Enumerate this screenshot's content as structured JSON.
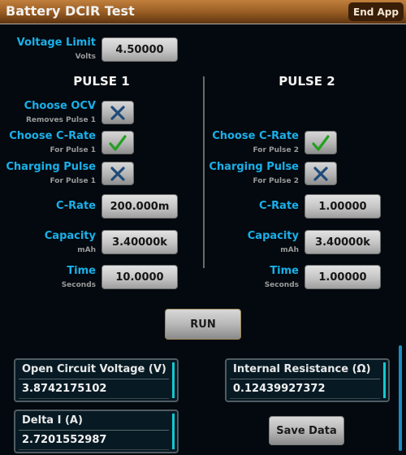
{
  "header": {
    "title": "Battery DCIR Test",
    "end_app_label": "End App"
  },
  "voltage_limit": {
    "label": "Voltage Limit",
    "unit": "Volts",
    "value": "4.50000"
  },
  "pulse1": {
    "title": "PULSE 1",
    "choose_ocv": {
      "label": "Choose OCV",
      "sub": "Removes Pulse 1",
      "checked": false,
      "icon": "x-icon"
    },
    "choose_crate": {
      "label": "Choose C-Rate",
      "sub": "For Pulse 1",
      "checked": true,
      "icon": "check-icon"
    },
    "charging_pulse": {
      "label": "Charging Pulse",
      "sub": "For Pulse 1",
      "checked": false,
      "icon": "x-icon"
    },
    "crate": {
      "label": "C-Rate",
      "value": "200.000m"
    },
    "capacity": {
      "label": "Capacity",
      "unit": "mAh",
      "value": "3.40000k"
    },
    "time": {
      "label": "Time",
      "unit": "Seconds",
      "value": "10.0000"
    }
  },
  "pulse2": {
    "title": "PULSE 2",
    "choose_crate": {
      "label": "Choose C-Rate",
      "sub": "For Pulse 2",
      "checked": true,
      "icon": "check-icon"
    },
    "charging_pulse": {
      "label": "Charging Pulse",
      "sub": "For Pulse 2",
      "checked": false,
      "icon": "x-icon"
    },
    "crate": {
      "label": "C-Rate",
      "value": "1.00000"
    },
    "capacity": {
      "label": "Capacity",
      "unit": "mAh",
      "value": "3.40000k"
    },
    "time": {
      "label": "Time",
      "unit": "Seconds",
      "value": "1.00000"
    }
  },
  "run_label": "RUN",
  "results": {
    "ocv": {
      "title": "Open Circuit Voltage (V)",
      "value": "3.8742175102"
    },
    "internal_resistance": {
      "title": "Internal Resistance (Ω)",
      "value": "0.12439927372"
    },
    "delta_i": {
      "title": "Delta I (A)",
      "value": "2.7201552987"
    }
  },
  "save_data_label": "Save Data",
  "colors": {
    "accent_label": "#1ab0ea",
    "header_brown": "#9a5e24",
    "check_green": "#22a020",
    "x_blue": "#1e4a7a",
    "result_bar": "#14c8d0"
  }
}
